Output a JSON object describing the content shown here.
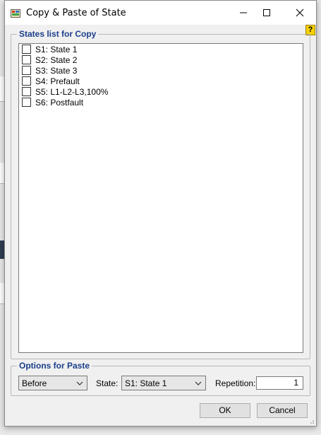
{
  "window": {
    "title": "Copy & Paste of State"
  },
  "help": {
    "label": "?"
  },
  "states_group": {
    "legend": "States list for Copy",
    "items": [
      {
        "label": "S1: State 1",
        "checked": false
      },
      {
        "label": "S2: State 2",
        "checked": false
      },
      {
        "label": "S3: State 3",
        "checked": false
      },
      {
        "label": "S4: Prefault",
        "checked": false
      },
      {
        "label": "S5: L1-L2-L3,100%",
        "checked": false
      },
      {
        "label": "S6: Postfault",
        "checked": false
      }
    ]
  },
  "paste_group": {
    "legend": "Options for Paste",
    "position_value": "Before",
    "state_label": "State:",
    "state_value": "S1: State 1",
    "repetition_label": "Repetition:",
    "repetition_value": "1"
  },
  "buttons": {
    "ok": "OK",
    "cancel": "Cancel"
  }
}
